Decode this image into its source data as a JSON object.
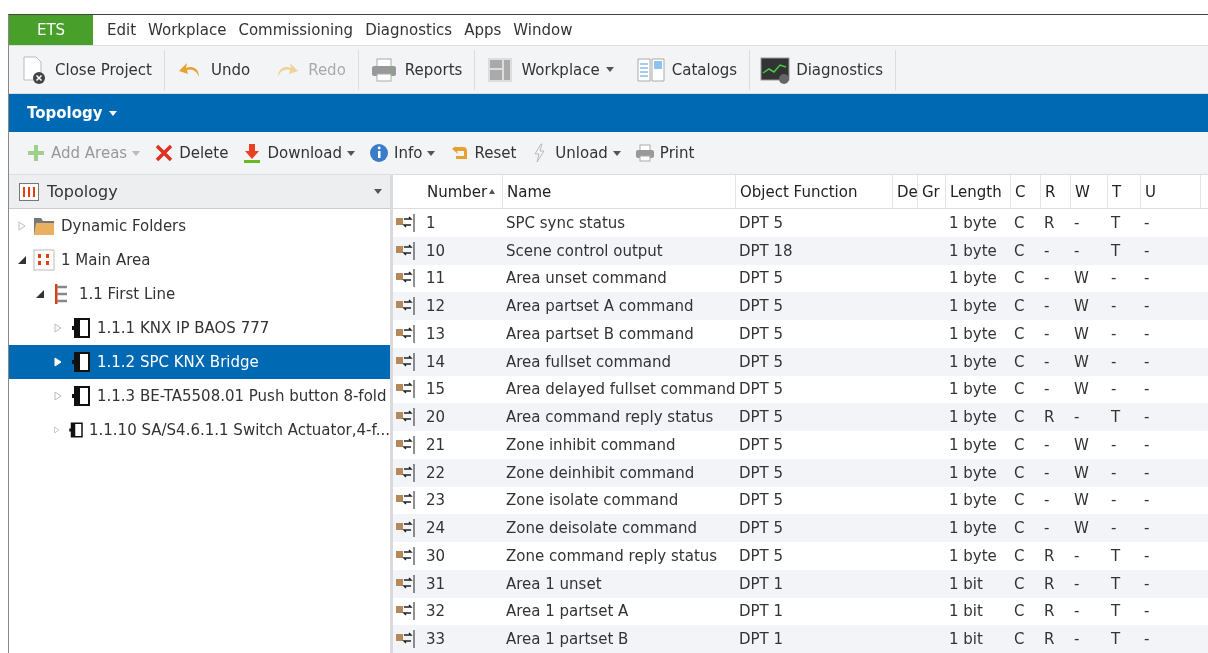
{
  "menu": {
    "app": "ETS",
    "items": [
      "Edit",
      "Workplace",
      "Commissioning",
      "Diagnostics",
      "Apps",
      "Window"
    ]
  },
  "toolbar": [
    {
      "label": "Close Project",
      "kind": "close",
      "disabled": false,
      "dropdown": false,
      "sep": true
    },
    {
      "label": "Undo",
      "kind": "undo",
      "disabled": false,
      "dropdown": false,
      "sep": false
    },
    {
      "label": "Redo",
      "kind": "redo",
      "disabled": true,
      "dropdown": false,
      "sep": true
    },
    {
      "label": "Reports",
      "kind": "printer",
      "disabled": false,
      "dropdown": false,
      "sep": true
    },
    {
      "label": "Workplace",
      "kind": "layout",
      "disabled": false,
      "dropdown": true,
      "sep": false
    },
    {
      "label": "Catalogs",
      "kind": "book",
      "disabled": false,
      "dropdown": false,
      "sep": true
    },
    {
      "label": "Diagnostics",
      "kind": "monitor",
      "disabled": false,
      "dropdown": false,
      "sep": true
    }
  ],
  "panel_title": "Topology",
  "actions": [
    {
      "label": "Add Areas",
      "kind": "add",
      "disabled": true,
      "dropdown": true
    },
    {
      "label": "Delete",
      "kind": "delete",
      "disabled": false,
      "dropdown": false
    },
    {
      "label": "Download",
      "kind": "download",
      "disabled": false,
      "dropdown": true
    },
    {
      "label": "Info",
      "kind": "info",
      "disabled": false,
      "dropdown": true
    },
    {
      "label": "Reset",
      "kind": "reset",
      "disabled": false,
      "dropdown": false
    },
    {
      "label": "Unload",
      "kind": "unload",
      "disabled": false,
      "dropdown": true
    },
    {
      "label": "Print",
      "kind": "printer",
      "disabled": false,
      "dropdown": false
    }
  ],
  "sidebar": {
    "title": "Topology",
    "tree": [
      {
        "label": "Dynamic Folders",
        "kind": "folder",
        "expanded": false,
        "selected": false
      },
      {
        "label": "1 Main Area",
        "kind": "area",
        "expanded": true,
        "selected": false,
        "children": [
          {
            "label": "1.1 First Line",
            "kind": "line",
            "expanded": true,
            "selected": false,
            "children": [
              {
                "label": "1.1.1 KNX IP BAOS 777",
                "kind": "device",
                "expanded": false,
                "selected": false
              },
              {
                "label": "1.1.2 SPC KNX Bridge",
                "kind": "device",
                "expanded": false,
                "selected": true
              },
              {
                "label": "1.1.3 BE-TA5508.01 Push button 8-fold",
                "kind": "device",
                "expanded": false,
                "selected": false
              },
              {
                "label": "1.1.10 SA/S4.6.1.1 Switch Actuator,4-f...",
                "kind": "device",
                "expanded": false,
                "selected": false
              }
            ]
          }
        ]
      }
    ]
  },
  "table": {
    "columns": [
      "Number",
      "Name",
      "Object Function",
      "De",
      "Gr",
      "Length",
      "C",
      "R",
      "W",
      "T",
      "U"
    ],
    "rows": [
      [
        "1",
        "SPC sync status",
        "DPT 5",
        "",
        "",
        "1 byte",
        "C",
        "R",
        "-",
        "T",
        "-"
      ],
      [
        "10",
        "Scene control output",
        "DPT 18",
        "",
        "",
        "1 byte",
        "C",
        "-",
        "-",
        "T",
        "-"
      ],
      [
        "11",
        "Area unset command",
        "DPT 5",
        "",
        "",
        "1 byte",
        "C",
        "-",
        "W",
        "-",
        "-"
      ],
      [
        "12",
        "Area partset A command",
        "DPT 5",
        "",
        "",
        "1 byte",
        "C",
        "-",
        "W",
        "-",
        "-"
      ],
      [
        "13",
        "Area partset B command",
        "DPT 5",
        "",
        "",
        "1 byte",
        "C",
        "-",
        "W",
        "-",
        "-"
      ],
      [
        "14",
        "Area fullset command",
        "DPT 5",
        "",
        "",
        "1 byte",
        "C",
        "-",
        "W",
        "-",
        "-"
      ],
      [
        "15",
        "Area delayed fullset command",
        "DPT 5",
        "",
        "",
        "1 byte",
        "C",
        "-",
        "W",
        "-",
        "-"
      ],
      [
        "20",
        "Area command reply status",
        "DPT 5",
        "",
        "",
        "1 byte",
        "C",
        "R",
        "-",
        "T",
        "-"
      ],
      [
        "21",
        "Zone inhibit command",
        "DPT 5",
        "",
        "",
        "1 byte",
        "C",
        "-",
        "W",
        "-",
        "-"
      ],
      [
        "22",
        "Zone deinhibit command",
        "DPT 5",
        "",
        "",
        "1 byte",
        "C",
        "-",
        "W",
        "-",
        "-"
      ],
      [
        "23",
        "Zone isolate command",
        "DPT 5",
        "",
        "",
        "1 byte",
        "C",
        "-",
        "W",
        "-",
        "-"
      ],
      [
        "24",
        "Zone deisolate command",
        "DPT 5",
        "",
        "",
        "1 byte",
        "C",
        "-",
        "W",
        "-",
        "-"
      ],
      [
        "30",
        "Zone command reply status",
        "DPT 5",
        "",
        "",
        "1 byte",
        "C",
        "R",
        "-",
        "T",
        "-"
      ],
      [
        "31",
        "Area 1 unset",
        "DPT 1",
        "",
        "",
        "1 bit",
        "C",
        "R",
        "-",
        "T",
        "-"
      ],
      [
        "32",
        "Area 1 partset A",
        "DPT 1",
        "",
        "",
        "1 bit",
        "C",
        "R",
        "-",
        "T",
        "-"
      ],
      [
        "33",
        "Area 1 partset B",
        "DPT 1",
        "",
        "",
        "1 bit",
        "C",
        "R",
        "-",
        "T",
        "-"
      ]
    ]
  }
}
